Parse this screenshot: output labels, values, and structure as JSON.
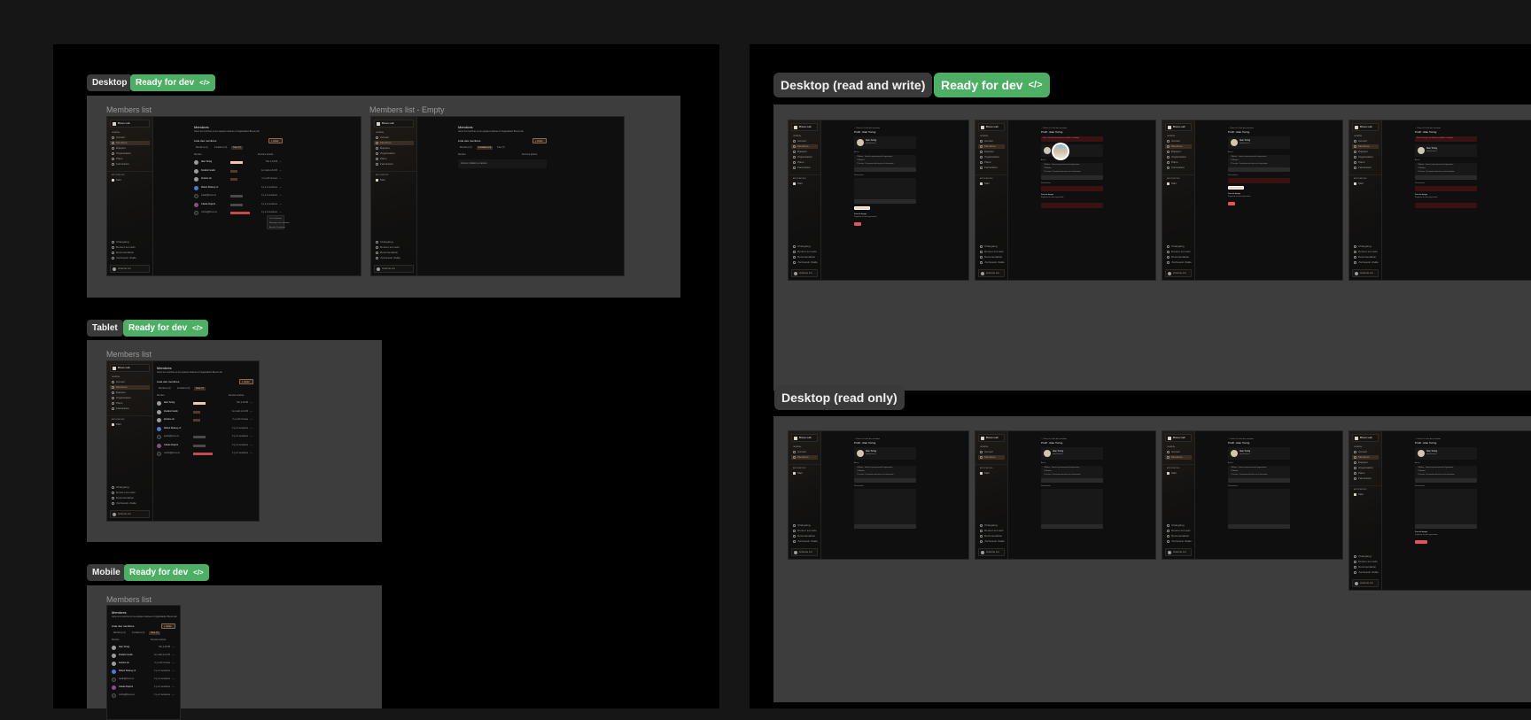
{
  "left_section": {
    "desktop": {
      "label": "Desktop",
      "status": "Ready for dev",
      "status_icon": "code-icon",
      "frames": [
        {
          "title": "Members list"
        },
        {
          "title": "Members list - Empty"
        }
      ]
    },
    "tablet": {
      "label": "Tablet",
      "status": "Ready for dev",
      "frames": [
        {
          "title": "Members list"
        }
      ]
    },
    "mobile": {
      "label": "Mobile",
      "status": "Ready for dev",
      "frames": [
        {
          "title": "Members list"
        }
      ]
    }
  },
  "right_section": {
    "read_write": {
      "label": "Desktop (read and write)",
      "status": "Ready for dev"
    },
    "read_only": {
      "label": "Desktop (read only)"
    }
  },
  "app": {
    "org_name": "Brevo Lab",
    "sidebar": {
      "general_heading": "GÉNÉRAL",
      "items": [
        "Accueil",
        "Membres",
        "Équipes",
        "Organisation",
        "Plans",
        "Facturation"
      ],
      "active_index": 1,
      "apps_heading": "APPLICATIONS",
      "apps": [
        "Mail"
      ],
      "footer_items": [
        "Changelog",
        "Donner son avis",
        "Documentation",
        "J'ai besoin d'aide"
      ],
      "user": "Antoine Lin"
    },
    "members_page": {
      "title": "Membres",
      "subtitle": "Gérer les membres et les équipes relatives à l'organisation Brevo Lab",
      "list_title": "Liste des membres",
      "invite_button": "+ Inviter",
      "tabs": [
        "Membres (4)",
        "Invitations (3)",
        "Tous (7)"
      ],
      "active_tab": 2,
      "columns": [
        "Membre",
        "Dernière activité"
      ],
      "rows": [
        {
          "name": "Alan Turing",
          "badge": "PROPRIÉTAIRE",
          "badge_color": "#f0c9a8",
          "activity": "Hier à 18:48"
        },
        {
          "name": "Frédéric Godin",
          "badge": "ADMIN",
          "badge_color": "#5a3a26",
          "activity": "Ce matin à 10:25"
        },
        {
          "name": "Antoine Lin",
          "badge": "ADMIN",
          "badge_color": "#5a3a26",
          "activity": "Il y a 20 minutes"
        },
        {
          "name": "Robert Downey Jr.",
          "badge": "",
          "badge_color": "",
          "activity": "Il y a 2 semaines"
        },
        {
          "name": "sarah@brevo.io",
          "badge": "EN ATTENTE",
          "badge_color": "#4a4a4a",
          "activity": "Il y a 2 semaines"
        },
        {
          "name": "Juliette Dupont",
          "badge": "EN ATTENTE",
          "badge_color": "#4a4a4a",
          "activity": "Il y a 2 semaines"
        },
        {
          "name": "michel@brevo.io",
          "badge": "INVITATION EXPIRÉE",
          "badge_color": "#c94a4a",
          "activity": "Il y a 2 semaines"
        }
      ],
      "row_menu": [
        "Voir l'invitation",
        "Renvoyer une invitation",
        "Annuler l'invitation"
      ],
      "empty_tab": 1,
      "empty_message": "Aucune invitation en attente"
    },
    "profile_page": {
      "back_link": "Retour à la liste des membres",
      "title": "Profil : Alan Turing",
      "name": "Alan Turing",
      "email": "alan@brevo.io",
      "access_heading": "Accès",
      "access_options": [
        "Admin : Toutes les permissions de l'organisation",
        "Membre",
        "Lecture : Permissions de lecture sur la facturation"
      ],
      "permissions_heading": "Permissions",
      "save_button": "Enregistrer les modifications",
      "danger_heading": "Zone de danger",
      "danger_title": "Supprimer de cette organisation",
      "delete_button": "Supprimer",
      "alert_text": "Vous n'avez pas les droits pour modifier ce membre"
    }
  },
  "colors": {
    "ready_green": "#4caf64",
    "chip_gray": "#3a3a3a",
    "frame_gray": "#3d3d3d",
    "canvas": "#161616",
    "accent_peach": "#f5d6bd",
    "danger_red": "#e05555"
  }
}
